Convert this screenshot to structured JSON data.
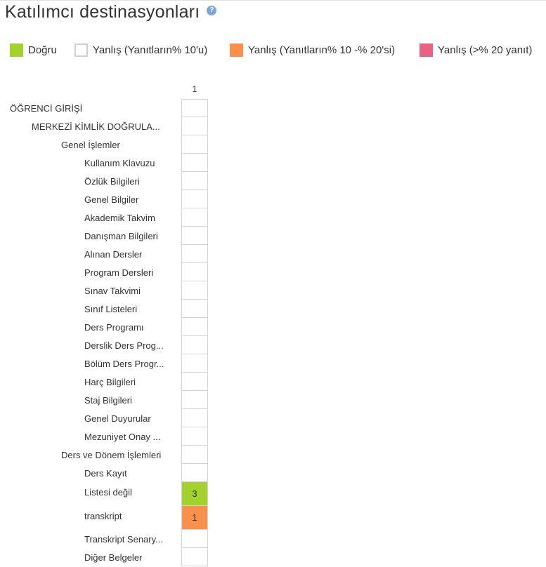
{
  "header": {
    "title": "Katılımcı destinasyonları",
    "help_icon": "?"
  },
  "colors": {
    "correct": "#a3d12e",
    "wrong_lt10": "#ffffff",
    "wrong_10_20": "#f9914c",
    "wrong_gt20": "#e8637f",
    "cell_border": "#d4d4d4"
  },
  "legend": [
    {
      "label": "Doğru",
      "color": "#a3d12e"
    },
    {
      "label": "Yanlış (Yanıtların% 10'u)",
      "color": "#ffffff"
    },
    {
      "label": "Yanlış (Yanıtların% 10 -% 20'si)",
      "color": "#f9914c"
    },
    {
      "label": "Yanlış (>% 20 yanıt)",
      "color": "#e8637f"
    }
  ],
  "columns": [
    "1"
  ],
  "rows": [
    {
      "label": "ÖĞRENCİ GİRİŞİ",
      "level": 0,
      "value": "",
      "status": "none"
    },
    {
      "label": "MERKEZİ KİMLİK DOĞRULA...",
      "level": 1,
      "value": "",
      "status": "none"
    },
    {
      "label": "Genel İşlemler",
      "level": 2,
      "value": "",
      "status": "none"
    },
    {
      "label": "Kullanım Klavuzu",
      "level": 3,
      "value": "",
      "status": "none"
    },
    {
      "label": "Özlük Bilgileri",
      "level": 3,
      "value": "",
      "status": "none"
    },
    {
      "label": "Genel Bilgiler",
      "level": 3,
      "value": "",
      "status": "none"
    },
    {
      "label": "Akademik Takvim",
      "level": 3,
      "value": "",
      "status": "none"
    },
    {
      "label": "Danışman Bilgileri",
      "level": 3,
      "value": "",
      "status": "none"
    },
    {
      "label": "Alınan Dersler",
      "level": 3,
      "value": "",
      "status": "none"
    },
    {
      "label": "Program Dersleri",
      "level": 3,
      "value": "",
      "status": "none"
    },
    {
      "label": "Sınav Takvimi",
      "level": 3,
      "value": "",
      "status": "none"
    },
    {
      "label": "Sınıf Listeleri",
      "level": 3,
      "value": "",
      "status": "none"
    },
    {
      "label": "Ders Programı",
      "level": 3,
      "value": "",
      "status": "none"
    },
    {
      "label": "Derslik Ders Prog...",
      "level": 3,
      "value": "",
      "status": "none"
    },
    {
      "label": "Bölüm Ders Progr...",
      "level": 3,
      "value": "",
      "status": "none"
    },
    {
      "label": "Harç Bilgileri",
      "level": 3,
      "value": "",
      "status": "none"
    },
    {
      "label": "Staj Bilgileri",
      "level": 3,
      "value": "",
      "status": "none"
    },
    {
      "label": "Genel Duyurular",
      "level": 3,
      "value": "",
      "status": "none"
    },
    {
      "label": "Mezuniyet Onay ...",
      "level": 3,
      "value": "",
      "status": "none"
    },
    {
      "label": "Ders ve Dönem İşlemleri",
      "level": 2,
      "value": "",
      "status": "none"
    },
    {
      "label": "Ders Kayıt",
      "level": 3,
      "value": "",
      "status": "none"
    },
    {
      "label": "Listesi değil",
      "level": 3,
      "value": "3",
      "status": "correct"
    },
    {
      "label": "transkript",
      "level": 3,
      "value": "1",
      "status": "wrong_10_20"
    },
    {
      "label": "Transkript Senary...",
      "level": 3,
      "value": "",
      "status": "none"
    },
    {
      "label": "Diğer Belgeler",
      "level": 3,
      "value": "",
      "status": "none"
    }
  ]
}
